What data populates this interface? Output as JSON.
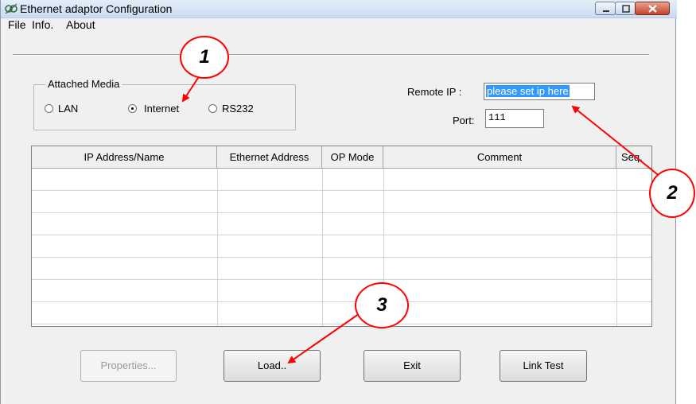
{
  "window": {
    "title": "Ethernet adaptor Configuration"
  },
  "menu": {
    "items": [
      "File",
      "Info.",
      "About"
    ]
  },
  "media": {
    "legend": "Attached Media",
    "options": [
      {
        "label": "LAN",
        "selected": false
      },
      {
        "label": "Internet",
        "selected": true
      },
      {
        "label": "RS232",
        "selected": false
      }
    ]
  },
  "remote": {
    "ip_label": "Remote IP :",
    "ip_value": "please set ip here",
    "port_label": "Port:",
    "port_value": "111"
  },
  "table": {
    "columns": [
      "IP Address/Name",
      "Ethernet Address",
      "OP Mode",
      "Comment",
      "Seq."
    ],
    "rows": [
      [
        "",
        "",
        "",
        "",
        ""
      ],
      [
        "",
        "",
        "",
        "",
        ""
      ],
      [
        "",
        "",
        "",
        "",
        ""
      ],
      [
        "",
        "",
        "",
        "",
        ""
      ],
      [
        "",
        "",
        "",
        "",
        ""
      ],
      [
        "",
        "",
        "",
        "",
        ""
      ],
      [
        "",
        "",
        "",
        "",
        ""
      ]
    ]
  },
  "buttons": {
    "properties": "Properties...",
    "load": "Load..",
    "exit": "Exit",
    "link_test": "Link Test"
  },
  "annotations": {
    "callout_1": "1",
    "callout_2": "2",
    "callout_3": "3",
    "color": "#ff0000"
  }
}
